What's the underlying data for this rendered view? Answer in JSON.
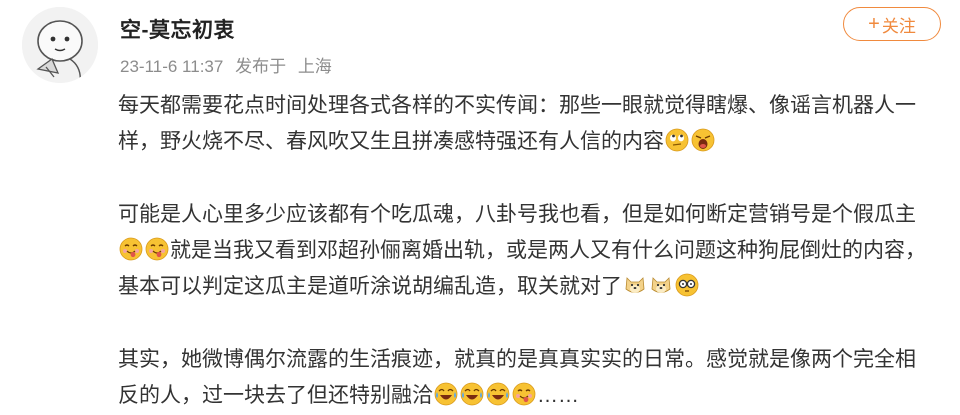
{
  "user": {
    "name": "空-莫忘初衷",
    "date": "23-11-6 11:37",
    "published_from": "发布于",
    "location": "上海"
  },
  "follow": {
    "plus": "+",
    "label": "关注"
  },
  "post": {
    "p1_text": "每天都需要花点时间处理各式各样的不实传闻：那些一眼就觉得瞎爆、像谣言机器人一样，野火烧不尽、春风吹又生且拼凑感特强还有人信的内容",
    "p2_a": "可能是人心里多少应该都有个吃瓜魂，八卦号我也看，但是如何断定营销号是个假瓜主",
    "p2_b": "就是当我又看到邓超孙俪离婚出轨，或是两人又有什么问题这种狗屁倒灶的内容，基本可以判定这瓜主是道听涂说胡编乱造，取关就对了",
    "p3_text": "其实，她微博偶尔流露的生活痕迹，就真的是真真实实的日常。感觉就是像两个完全相反的人，过一块去了但还特别融洽",
    "p3_ellipsis": "……"
  },
  "emoji_names": {
    "rolling_eyes": "rolling-eyes-emoji",
    "shocked": "shocked-emoji",
    "tongue": "tongue-emoji",
    "doge": "doge-emoji",
    "glasses": "glasses-emoji",
    "laugh_cry": "laugh-cry-emoji"
  },
  "colors": {
    "accent": "#f08a3e",
    "text": "#333333",
    "meta": "#8c8c8c",
    "emoji_yellow": "#f7c233"
  }
}
